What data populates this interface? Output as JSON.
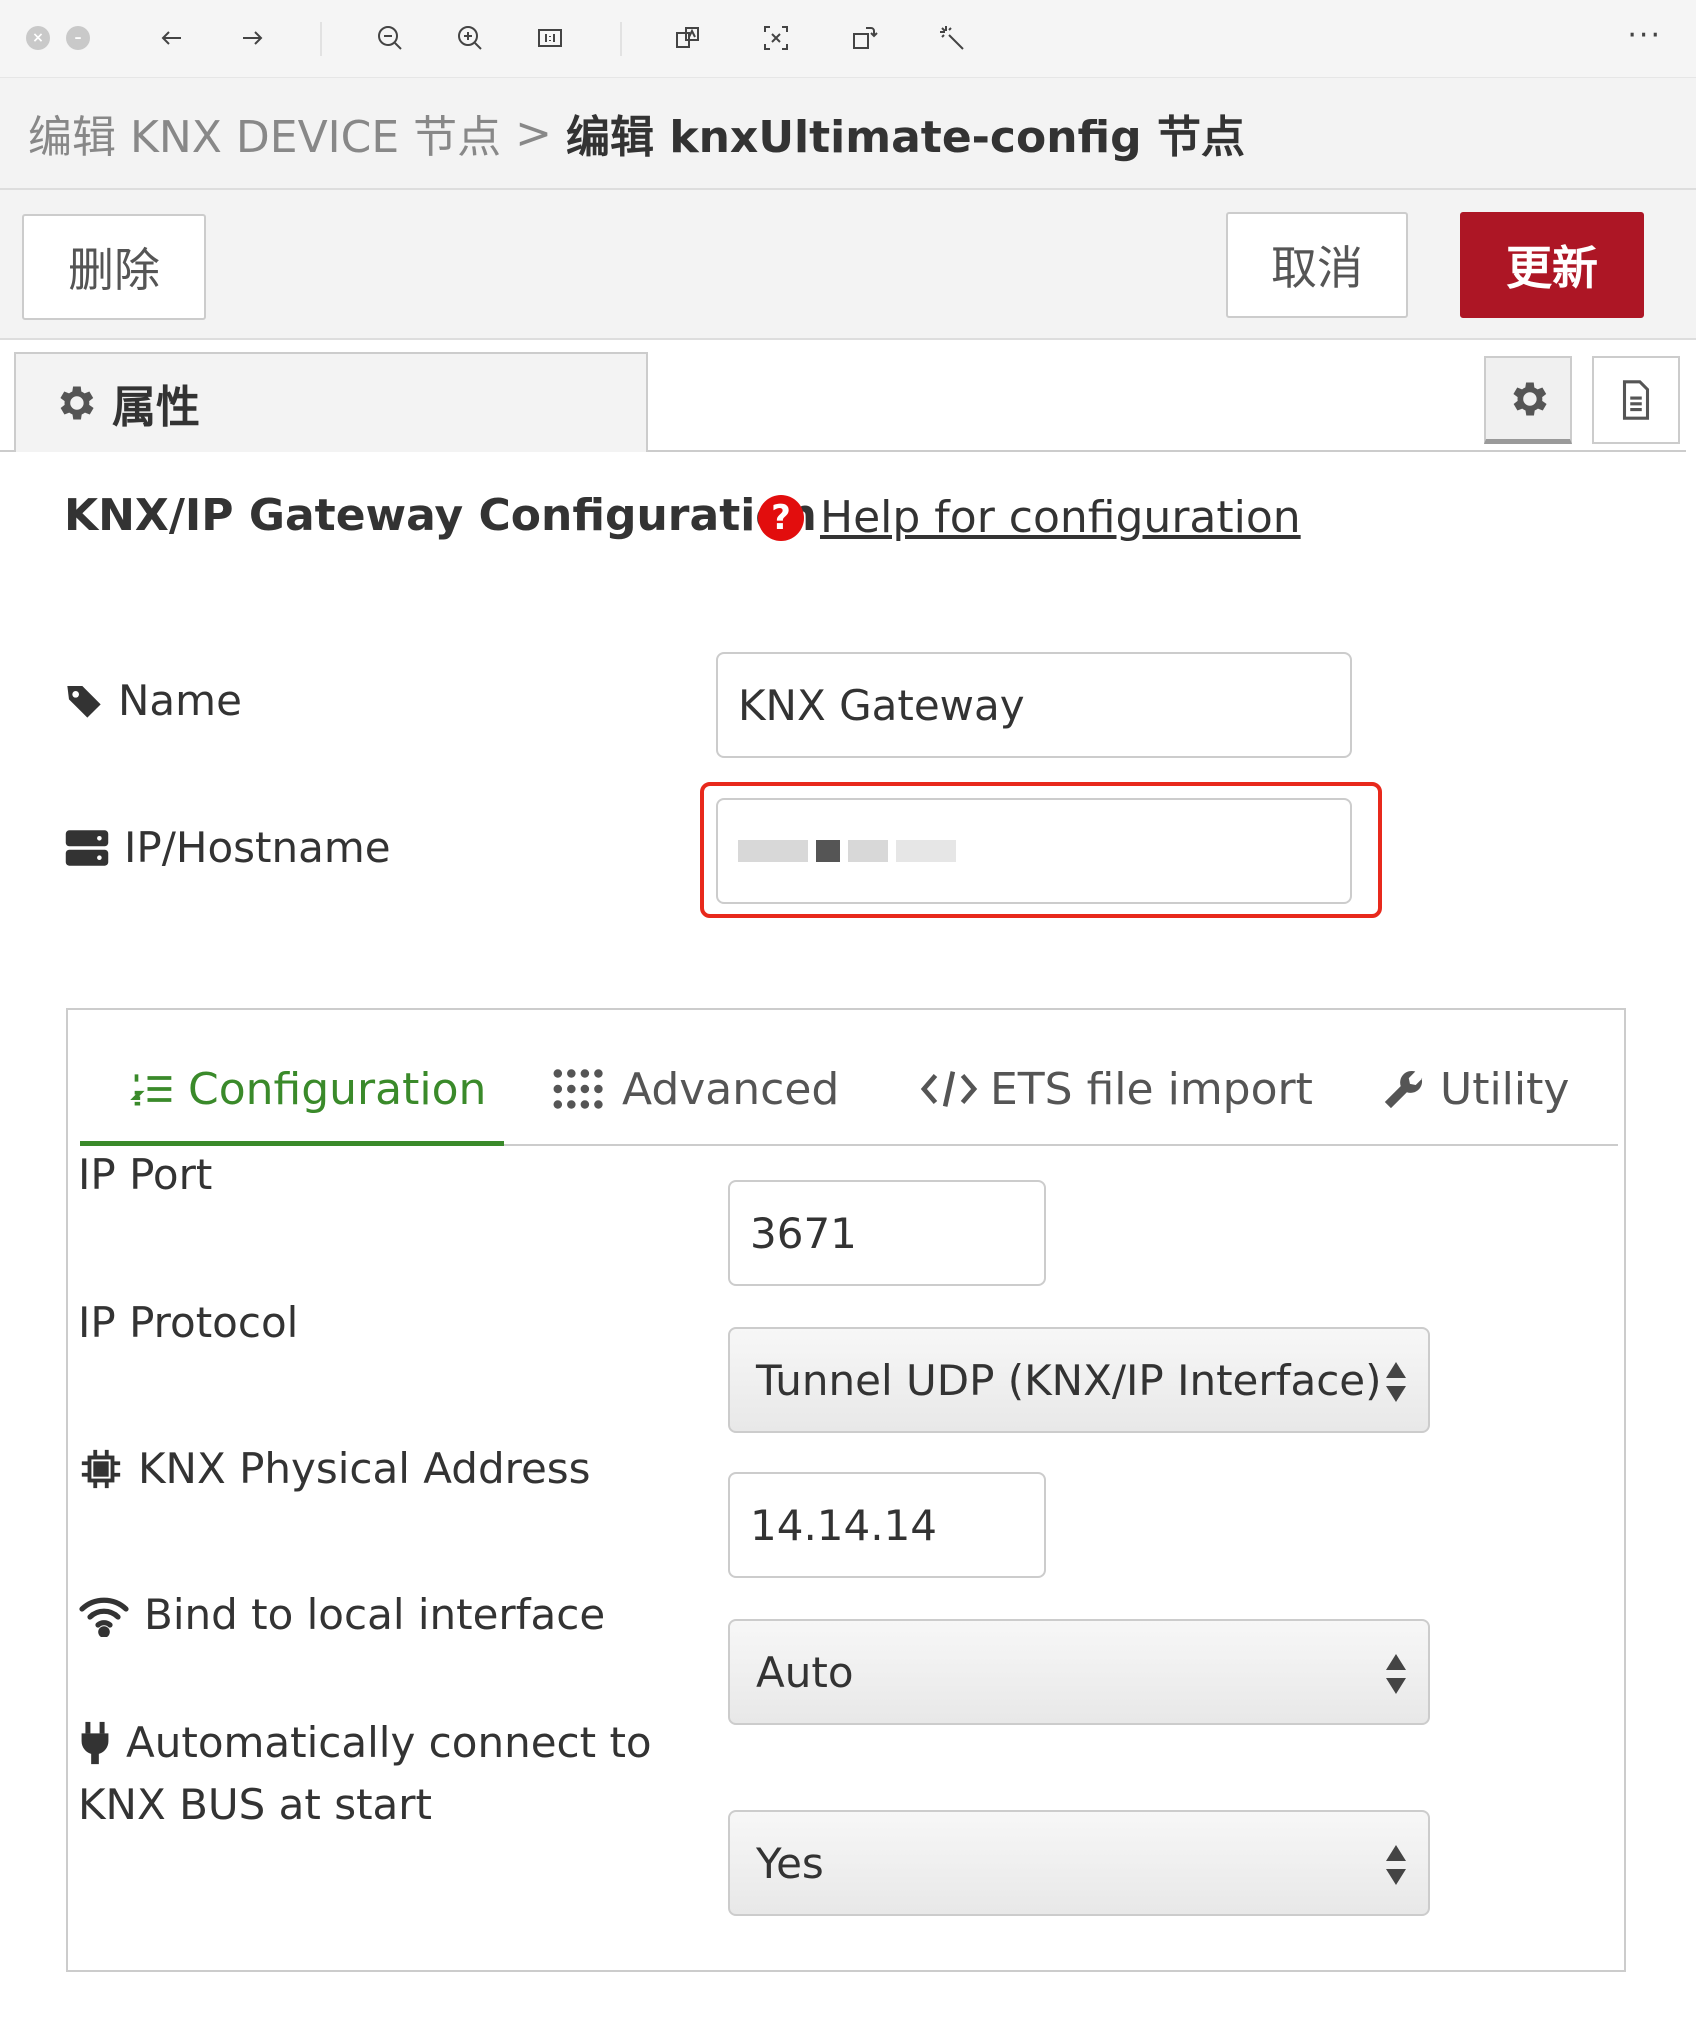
{
  "viewer": {
    "more_label": "···"
  },
  "breadcrumb": {
    "parent": "编辑 KNX DEVICE 节点",
    "separator": ">",
    "current": "编辑 knxUltimate-config 节点"
  },
  "actions": {
    "delete_label": "删除",
    "cancel_label": "取消",
    "update_label": "更新"
  },
  "tabs": {
    "properties_label": "属性"
  },
  "form": {
    "title": "KNX/IP Gateway Configuration",
    "help_icon": "?",
    "help_link": "Help for configuration",
    "name_label": "Name",
    "name_value": "KNX Gateway",
    "host_label": "IP/Hostname"
  },
  "inner_tabs": [
    {
      "label": "Configuration",
      "icon": "list-ordered-icon",
      "active": true
    },
    {
      "label": "Advanced",
      "icon": "grid-dots-icon",
      "active": false
    },
    {
      "label": "ETS file import",
      "icon": "code-icon",
      "active": false
    },
    {
      "label": "Utility",
      "icon": "wrench-icon",
      "active": false
    }
  ],
  "config": {
    "port_label": "IP Port",
    "port_value": "3671",
    "protocol_label": "IP Protocol",
    "protocol_value": "Tunnel UDP (KNX/IP Interface)",
    "physical_label": "KNX Physical Address",
    "physical_value": "14.14.14",
    "bind_label": "Bind to local interface",
    "bind_value": "Auto",
    "autoconnect_label_line1": "Automatically connect to",
    "autoconnect_label_line2": "KNX BUS at start",
    "autoconnect_value": "Yes"
  },
  "colors": {
    "update_button": "#ad1625",
    "active_tab": "#3a8a2a",
    "highlight": "#e8291c",
    "help_icon": "#e20d0d"
  }
}
